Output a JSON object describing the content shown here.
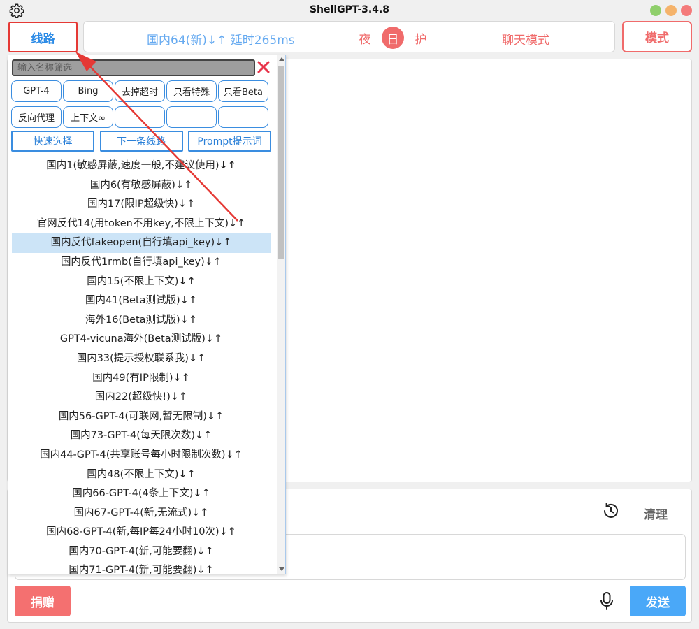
{
  "window": {
    "title": "ShellGPT-3.4.8"
  },
  "header": {
    "route_button": "线路",
    "route_info": "国内64(新)↓↑ 延时265ms",
    "theme_night": "夜",
    "theme_day": "日",
    "theme_eye": "护",
    "chat_mode": "聊天模式",
    "mode_button": "模式"
  },
  "dropdown": {
    "filter_placeholder": "输入名称筛选",
    "chips": [
      "GPT-4",
      "Bing",
      "去掉超时",
      "只看特殊",
      "只看Beta",
      "反向代理",
      "上下文∞",
      "",
      "",
      ""
    ],
    "actions": [
      "快速选择",
      "下一条线路",
      "Prompt提示词"
    ],
    "routes": [
      "国内1(敏感屏蔽,速度一般,不建议使用)↓↑",
      "国内6(有敏感屏蔽)↓↑",
      "国内17(限IP超级快)↓↑",
      "官网反代14(用token不用key,不限上下文)↓↑",
      "国内反代fakeopen(自行填api_key)↓↑",
      "国内反代1rmb(自行填api_key)↓↑",
      "国内15(不限上下文)↓↑",
      "国内41(Beta测试版)↓↑",
      "海外16(Beta测试版)↓↑",
      "GPT4-vicuna海外(Beta测试版)↓↑",
      "国内33(提示授权联系我)↓↑",
      "国内49(有IP限制)↓↑",
      "国内22(超级快!)↓↑",
      "国内56-GPT-4(可联网,暂无限制)↓↑",
      "国内73-GPT-4(每天限次数)↓↑",
      "国内44-GPT-4(共享账号每小时限制次数)↓↑",
      "国内48(不限上下文)↓↑",
      "国内66-GPT-4(4条上下文)↓↑",
      "国内67-GPT-4(新,无流式)↓↑",
      "国内68-GPT-4(新,每IP每24小时10次)↓↑",
      "国内70-GPT-4(新,可能要翻)↓↑",
      "国内71-GPT-4(新,可能要翻)↓↑"
    ],
    "selected_index": 4
  },
  "bottom": {
    "clear_button": "清理",
    "donate_button": "捐赠",
    "send_button": "发送"
  },
  "colors": {
    "accent_blue": "#2a8ae6",
    "accent_red": "#f06b6b",
    "highlight_border": "#e53935",
    "selected_row": "#cce4f7"
  },
  "icons": [
    "gear-icon",
    "history-icon",
    "microphone-icon",
    "close-x-icon"
  ]
}
